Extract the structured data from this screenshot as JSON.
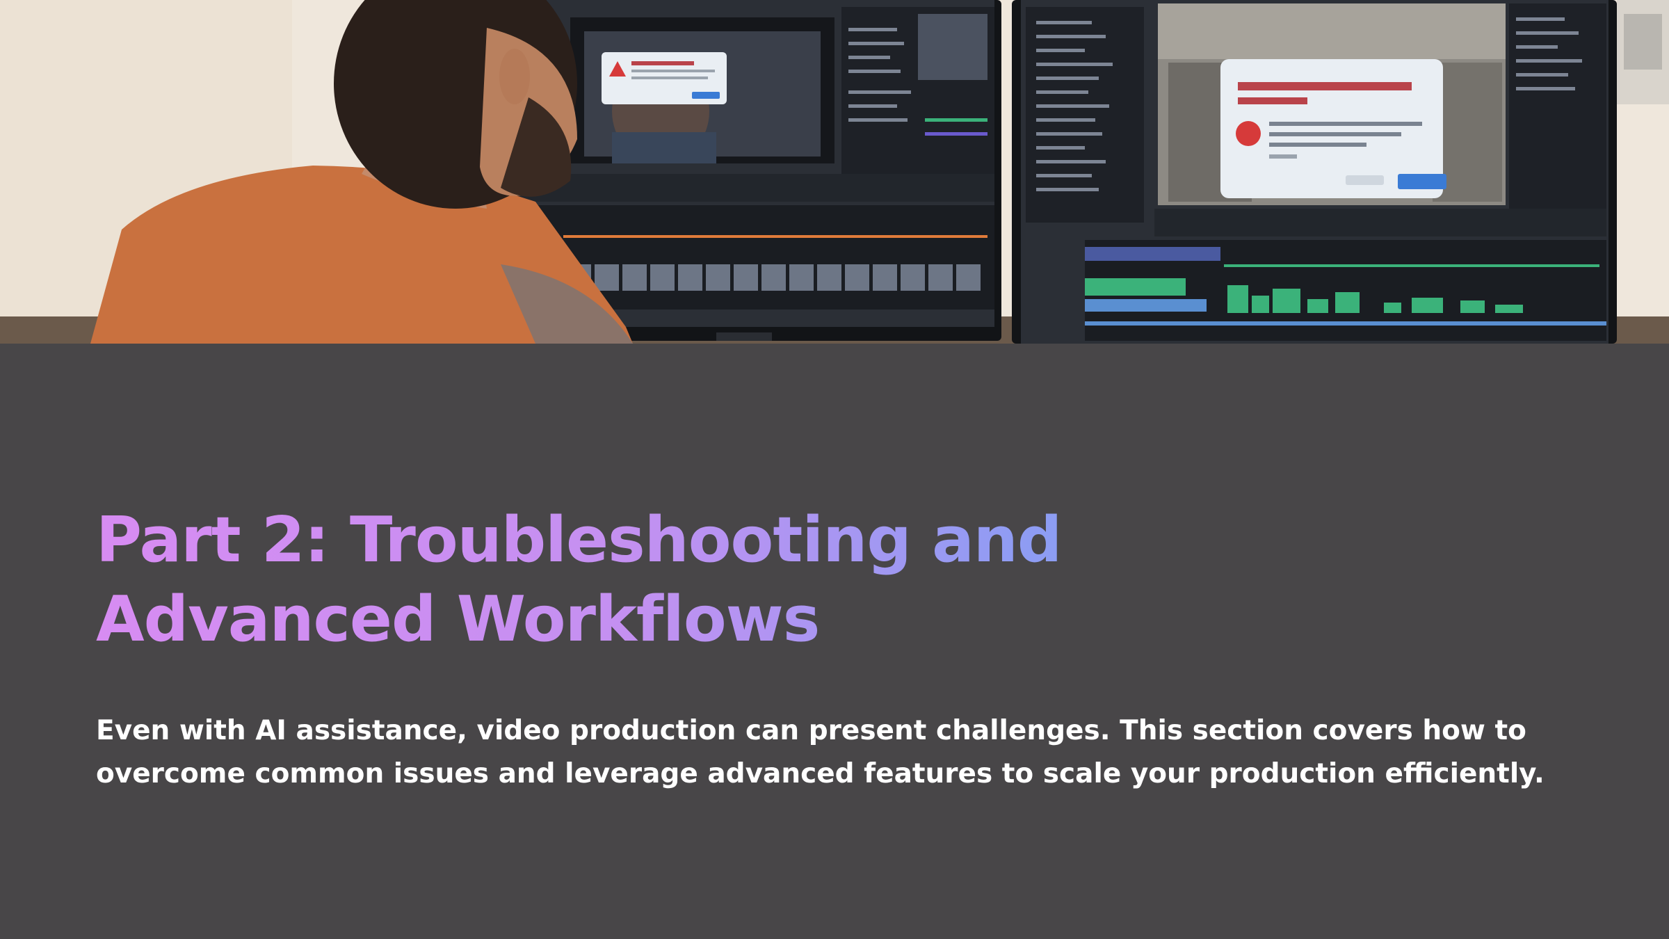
{
  "hero_image": {
    "subject": "person-editing-video-at-dual-monitors",
    "colors": {
      "wall": "#efe7dc",
      "shirt": "#c9713f",
      "hair": "#2a1f1a",
      "screen": "#2b2f36",
      "panel": "#1e2127",
      "timeline_green": "#3bb27a",
      "alert_red": "#d63a3a",
      "dialog": "#e9eef3",
      "button_blue": "#3a7bd5"
    }
  },
  "section": {
    "title": "Part 2: Troubleshooting and Advanced Workflows",
    "body": "Even with AI assistance, video production can present challenges. This section covers how to overcome common issues and leverage advanced features to scale your production efficiently."
  },
  "colors": {
    "background": "#484648",
    "title_gradient_start": "#d78cf2",
    "title_gradient_end": "#76a9f0",
    "body_text": "#ffffff"
  }
}
